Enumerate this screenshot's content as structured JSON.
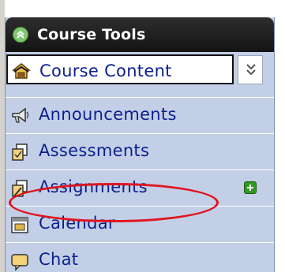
{
  "panel": {
    "title": "Course Tools",
    "collapse_icon": "collapse-up-icon",
    "dropdown_icon": "double-chevron-down-icon"
  },
  "selected": {
    "label": "Course Content",
    "icon": "course-content-icon"
  },
  "items": [
    {
      "label": "Announcements",
      "icon": "megaphone-icon"
    },
    {
      "label": "Assessments",
      "icon": "assessments-icon"
    },
    {
      "label": "Assignments",
      "icon": "assignments-icon",
      "action_icon": "add-icon",
      "highlighted": true
    },
    {
      "label": "Calendar",
      "icon": "calendar-icon"
    },
    {
      "label": "Chat",
      "icon": "chat-icon"
    }
  ],
  "colors": {
    "panel_bg": "#c3cfe6",
    "header_bg": "#131313",
    "link_text": "#0c1f8f",
    "highlight": "#e0141e",
    "add_green": "#2f9a22"
  }
}
